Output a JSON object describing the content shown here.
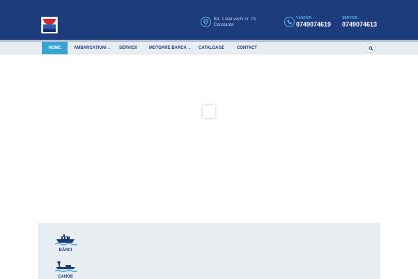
{
  "header": {
    "address_line1": "Bd. 1 Mai vechi nr. 73,",
    "address_line2": "Constanța",
    "sales_label": "VÂNZĂRI :",
    "sales_phone": "0749074619",
    "service_label": "SERVICE :",
    "service_phone": "0749074613",
    "logo_icon": "company-logo",
    "address_icon": "location-pin-icon",
    "phone_icon": "phone-icon"
  },
  "nav": {
    "items": [
      {
        "label": "HOME",
        "active": true,
        "dropdown": false
      },
      {
        "label": "AMBARCAȚIUNI",
        "active": false,
        "dropdown": true
      },
      {
        "label": "SERVICII",
        "active": false,
        "dropdown": false
      },
      {
        "label": "MOTOARE BARCĂ",
        "active": false,
        "dropdown": true
      },
      {
        "label": "CATALOAGE",
        "active": false,
        "dropdown": false
      },
      {
        "label": "CONTACT",
        "active": false,
        "dropdown": false
      }
    ],
    "search_icon": "search-icon"
  },
  "categories": [
    {
      "label": "BĂRCI",
      "icon": "boat-icon"
    },
    {
      "label": "CANOE",
      "icon": "canoe-icon"
    }
  ],
  "colors": {
    "header_bg": "#1d3c7c",
    "accent": "#3aa3d6",
    "nav_bg": "#e8edf2"
  }
}
